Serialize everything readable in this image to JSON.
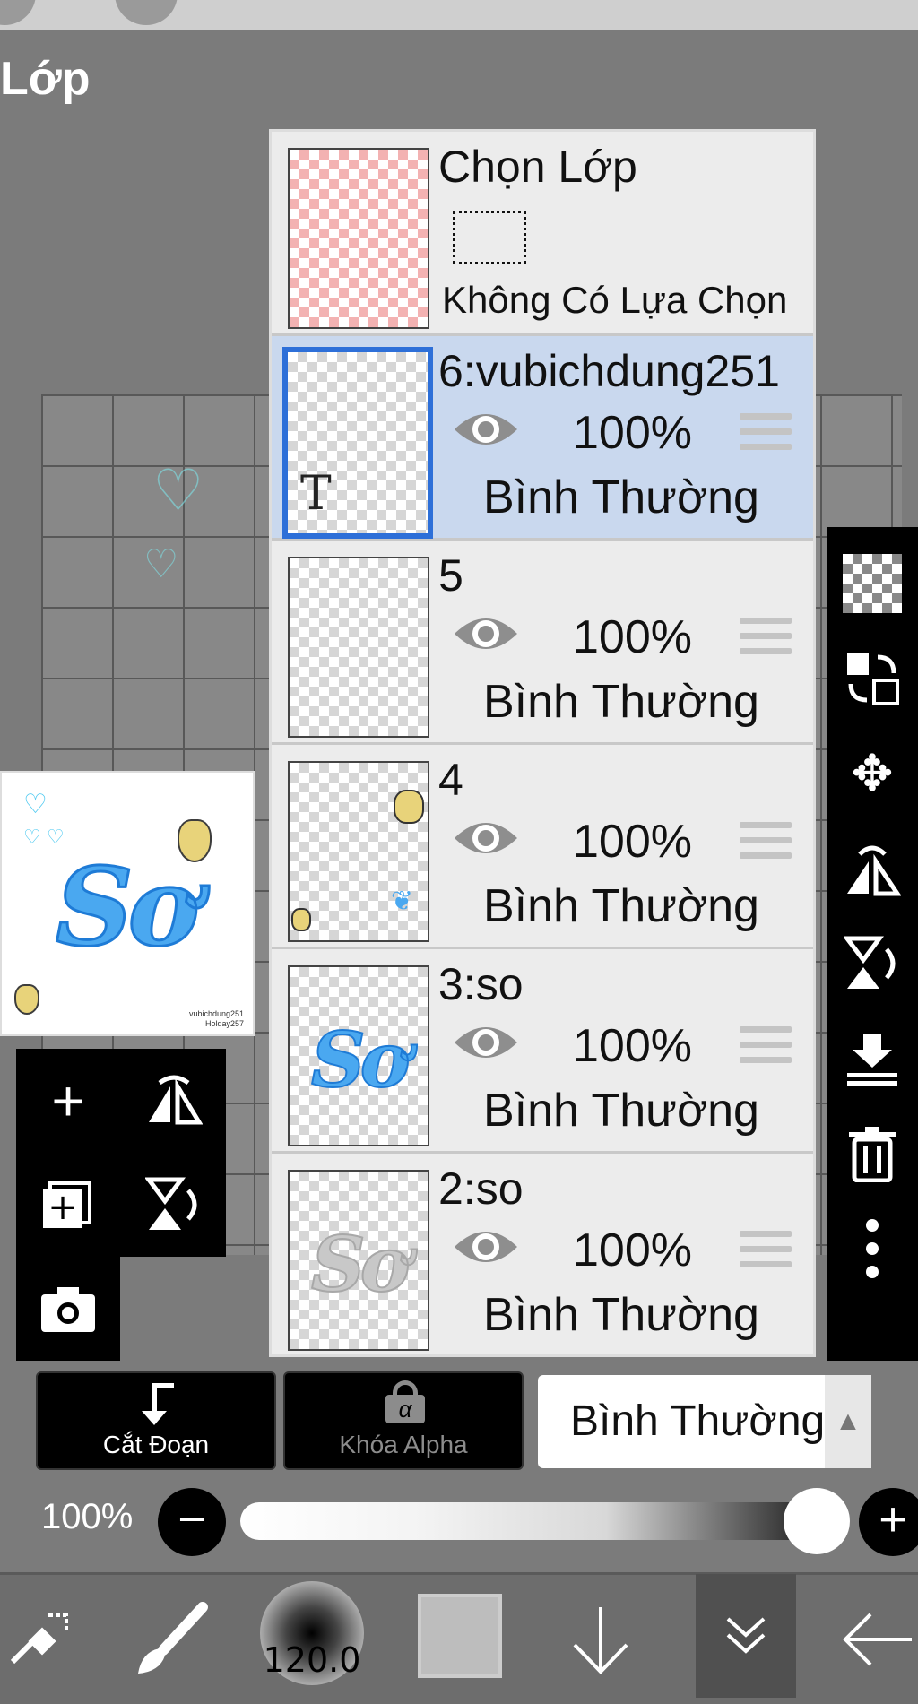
{
  "header": {
    "title": "Lớp"
  },
  "layer_panel": {
    "selection_layer": {
      "name": "Chọn Lớp",
      "status": "Không Có Lựa Chọn"
    },
    "layers": [
      {
        "name": "6:vubichdung251",
        "opacity": "100%",
        "mode": "Bình Thường",
        "selected": true,
        "thumb_icon": "T"
      },
      {
        "name": "5",
        "opacity": "100%",
        "mode": "Bình Thường",
        "selected": false
      },
      {
        "name": "4",
        "opacity": "100%",
        "mode": "Bình Thường",
        "selected": false
      },
      {
        "name": "3:so",
        "opacity": "100%",
        "mode": "Bình Thường",
        "selected": false,
        "thumb_text": "Sơ"
      },
      {
        "name": "2:so",
        "opacity": "100%",
        "mode": "Bình Thường",
        "selected": false,
        "thumb_text": "Sơ"
      }
    ]
  },
  "preview": {
    "art_text": "Sơ",
    "signature": "vubichdung251\nHolday257"
  },
  "actions": {
    "clip_label": "Cắt Đoạn",
    "alpha_lock_label": "Khóa Alpha",
    "alpha_symbol": "α",
    "blend_mode": "Bình Thường"
  },
  "opacity": {
    "label": "100%",
    "value": 1.0
  },
  "brush": {
    "size": "120.0"
  },
  "icons": {
    "left_tools": [
      "add-layer-icon",
      "flip-horizontal-icon",
      "add-layer-copy-icon",
      "flip-vertical-icon",
      "camera-icon"
    ],
    "right_tools": [
      "transparency-icon",
      "swap-layer-icon",
      "move-icon",
      "rotate-flip-icon",
      "flip-vertical-icon",
      "merge-down-icon",
      "trash-icon",
      "more-icon"
    ],
    "bottom": [
      "transform-icon",
      "brush-icon",
      "brush-size",
      "color-swatch",
      "arrow-down-icon",
      "double-chevron-down-icon",
      "back-arrow-icon"
    ]
  },
  "colors": {
    "selected_row": "#c9d8ee",
    "selected_border": "#2d6fd8",
    "accent_blue": "#4aa8f0"
  }
}
